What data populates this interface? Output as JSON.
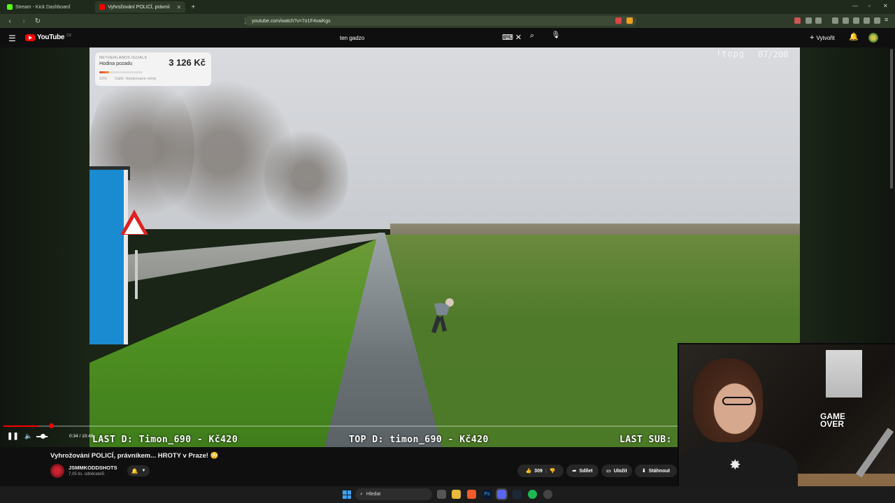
{
  "browser": {
    "tabs": [
      {
        "label": "Stream - Kick Dashboard",
        "active": false
      },
      {
        "label": "Vyhrožování POLICÍ, právníi",
        "active": true
      }
    ],
    "url": "youtube.com/watch?v=7o1F4vaiKgs"
  },
  "header": {
    "logo_text": "YouTube",
    "logo_region": "CZ",
    "search_value": "ten gadzo",
    "create_label": "Vytvořit"
  },
  "overlay": {
    "donate_title": "NETHERLANDS IGOALS",
    "donate_subtitle": "Hodina pozadu",
    "donate_amount": "3 126 Kč",
    "donate_progress": 0.22,
    "donate_percent": "22%",
    "donate_next": "Další: Nalakovane nehty",
    "top_right_label": "!topg",
    "top_right_count": "87/200"
  },
  "ticker": {
    "last_donation": "LAST D: Timon_690 - Kč420",
    "top_donation": "TOP D: timon_690 - Kč420",
    "last_sub": "LAST SUB:"
  },
  "player": {
    "time": "0:34 / 10:48",
    "progress": 0.052
  },
  "video": {
    "title": "Vyhrožování POLICÍ, právníkem... HROTY v Praze! 😳",
    "channel": "JSMMKODDSHOTS",
    "subscribers": "7,05 tis. odběratelů",
    "likes": "309",
    "share_label": "Sdílet",
    "save_label": "Uložit",
    "download_label": "Stáhnout"
  },
  "webcam": {
    "poster_text": "GAME OVER"
  },
  "taskbar": {
    "search_placeholder": "Hledat"
  },
  "colors": {
    "accent": "#ff0000",
    "browser_chrome": "#2f3b2a"
  }
}
